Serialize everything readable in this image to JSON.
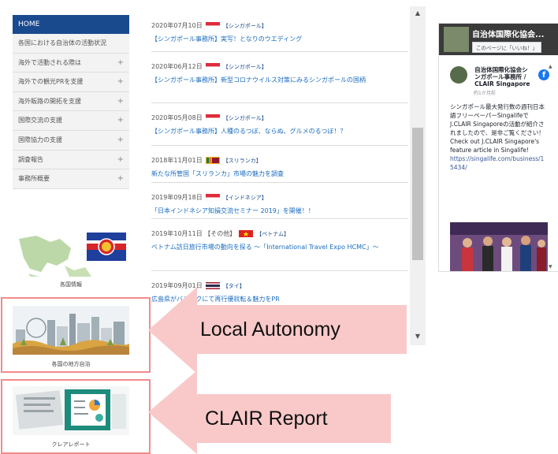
{
  "sidebar": {
    "home": "HOME",
    "items": [
      {
        "label": "各国における自治体の活動状況",
        "plus": ""
      },
      {
        "label": "海外で活動される際は",
        "plus": "+"
      },
      {
        "label": "海外での観光PRを支援",
        "plus": "+"
      },
      {
        "label": "海外販路の開拓を支援",
        "plus": "+"
      },
      {
        "label": "国際交流の支援",
        "plus": "+"
      },
      {
        "label": "国際協力の支援",
        "plus": "+"
      },
      {
        "label": "調査報告",
        "plus": "+"
      },
      {
        "label": "事務所概要",
        "plus": "+"
      }
    ]
  },
  "banners": [
    {
      "caption": "各国情報"
    },
    {
      "caption": "各国の地方自治"
    },
    {
      "caption": "クレアレポート"
    }
  ],
  "news": [
    {
      "date": "2020年07月10日",
      "category": "【シンガポール】",
      "flag": "singapore",
      "title": "【シンガポール事務所】実写！となりのウエディング"
    },
    {
      "date": "2020年06月12日",
      "category": "【シンガポール】",
      "flag": "singapore",
      "title": "【シンガポール事務所】新型コロナウイルス対策にみるシンガポールの国柄"
    },
    {
      "date": "2020年05月08日",
      "category": "【シンガポール】",
      "flag": "singapore",
      "title": "【シンガポール事務所】人種のるつぼ、ならぬ、グルメのるつぼ！？"
    },
    {
      "date": "2018年11月01日",
      "category": "【スリランカ】",
      "flag": "srilanka",
      "title": "新たな所管国「スリランカ」市場の魅力を調査"
    },
    {
      "date": "2019年09月18日",
      "category": "【インドネシア】",
      "flag": "indonesia",
      "title": "「日本インドネシア知損交流セミナー 2019」を開催！！"
    },
    {
      "date": "2019年10月11日 【その他】",
      "category": "【ベトナム】",
      "flag": "vietnam",
      "title": "ベトナム訪日旅行市場の動向を探る 〜「International Travel Expo HCMC」〜"
    },
    {
      "date": "2019年09月01日",
      "category": "【タイ】",
      "flag": "thailand",
      "title": "広島県がバンコクにて再行優就転＆魅力をPR"
    }
  ],
  "callouts": {
    "local_autonomy": "Local Autonomy",
    "clair_report": "CLAIR Report"
  },
  "facebook": {
    "page_title": "自治体国際化協会...",
    "like_label": "このページに「いいね！」",
    "post_author": "自治体国際化協会シンガポール事務所 / CLAIR Singapore",
    "post_time": "約1か月前",
    "post_text": "シンガポール最大発行数の週刊日本語フリーペーパーSingalifeでJ.CLAIR Singaporeの活動が紹介されましたので、是非ご覧ください！ Check out J.CLAIR Singapore's feature article in Singalife!",
    "post_link": "https://singalife.com/business/15434/"
  },
  "colors": {
    "home_bg": "#1a4a8e",
    "link": "#1a6cbf",
    "highlight": "#f28b8b",
    "callout_bg": "#f9c9c9"
  }
}
